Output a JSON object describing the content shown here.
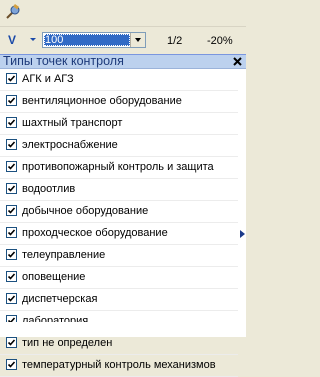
{
  "toolbar": {
    "version_label": "V",
    "zoom_value": "100",
    "page_info": "1/2",
    "zoom_change": "-20%"
  },
  "panel": {
    "title": "Типы точек контроля",
    "items": [
      {
        "label": "АГК и АГЗ",
        "checked": true
      },
      {
        "label": "вентиляционное оборудование",
        "checked": true
      },
      {
        "label": "шахтный транспорт",
        "checked": true
      },
      {
        "label": "электроснабжение",
        "checked": true
      },
      {
        "label": "противопожарный контроль и защита",
        "checked": true
      },
      {
        "label": "водоотлив",
        "checked": true
      },
      {
        "label": "добычное оборудование",
        "checked": true
      },
      {
        "label": "проходческое оборудование",
        "checked": true
      },
      {
        "label": "телеуправление",
        "checked": true
      },
      {
        "label": "оповещение",
        "checked": true
      },
      {
        "label": "диспетчерская",
        "checked": true
      },
      {
        "label": "лаборатория",
        "checked": true
      },
      {
        "label": "тип не определен",
        "checked": true
      },
      {
        "label": "температурный контроль механизмов",
        "checked": true
      }
    ]
  }
}
